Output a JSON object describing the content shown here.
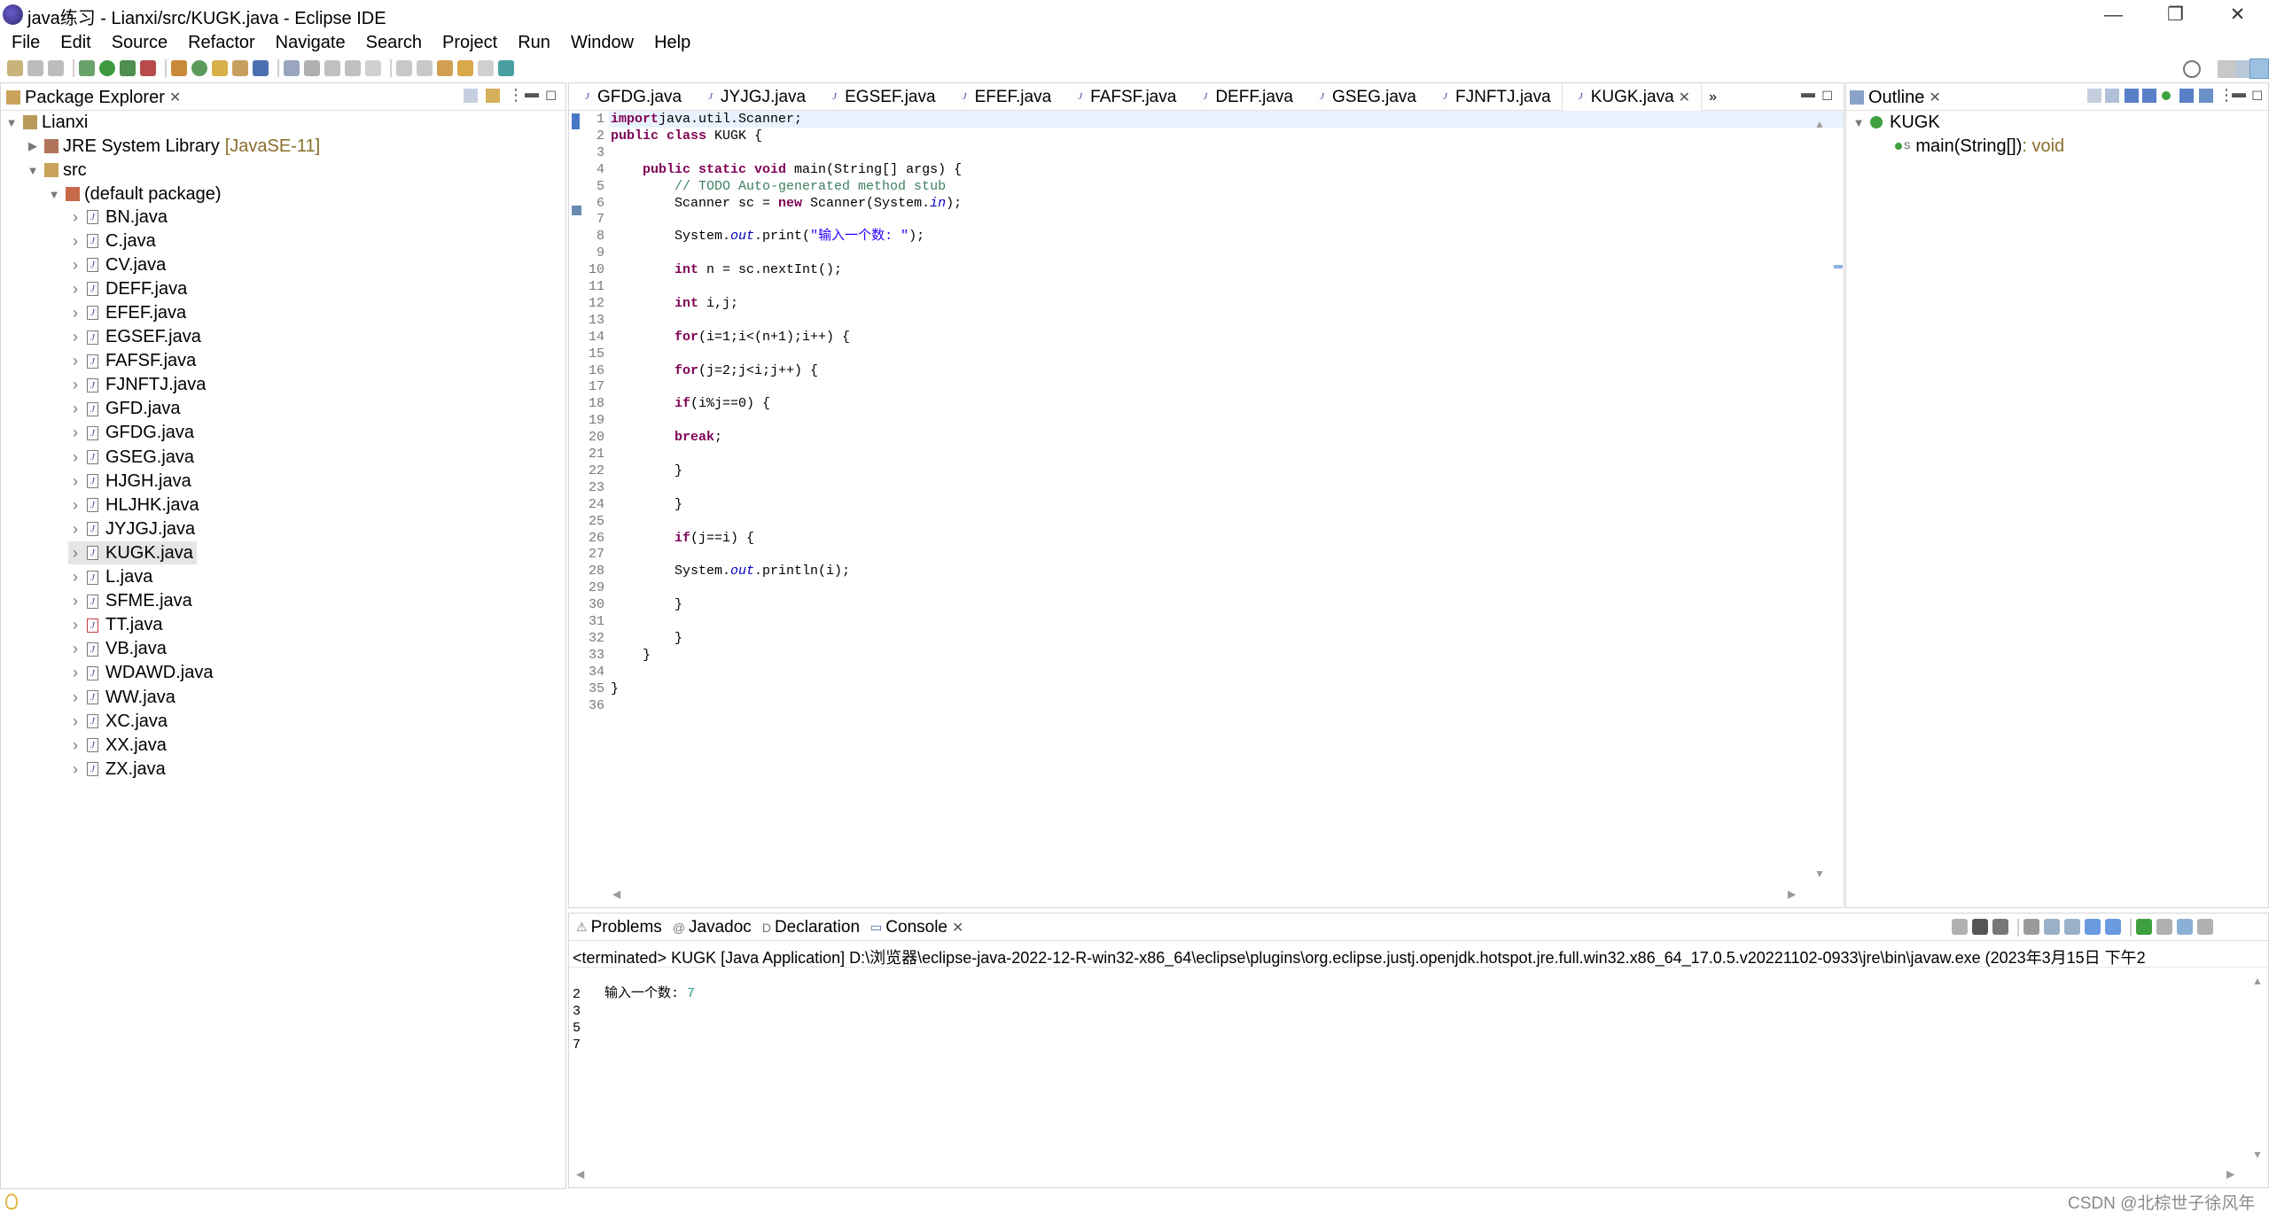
{
  "window": {
    "title": "java练习 - Lianxi/src/KUGK.java - Eclipse IDE",
    "minimize_glyph": "—",
    "restore_glyph": "❐",
    "close_glyph": "✕"
  },
  "menu": [
    "File",
    "Edit",
    "Source",
    "Refactor",
    "Navigate",
    "Search",
    "Project",
    "Run",
    "Window",
    "Help"
  ],
  "package_explorer": {
    "title": "Package Explorer",
    "project": "Lianxi",
    "jre_label": "JRE System Library",
    "jre_version": "[JavaSE-11]",
    "src": "src",
    "default_package": "(default package)",
    "files": [
      "BN.java",
      "C.java",
      "CV.java",
      "DEFF.java",
      "EFEF.java",
      "EGSEF.java",
      "FAFSF.java",
      "FJNFTJ.java",
      "GFD.java",
      "GFDG.java",
      "GSEG.java",
      "HJGH.java",
      "HLJHK.java",
      "JYJGJ.java",
      "KUGK.java",
      "L.java",
      "SFME.java",
      "TT.java",
      "VB.java",
      "WDAWD.java",
      "WW.java",
      "XC.java",
      "XX.java",
      "ZX.java"
    ],
    "selected_file": "KUGK.java"
  },
  "editor": {
    "tabs": [
      "GFDG.java",
      "JYJGJ.java",
      "EGSEF.java",
      "EFEF.java",
      "FAFSF.java",
      "DEFF.java",
      "GSEG.java",
      "FJNFTJ.java",
      "KUGK.java"
    ],
    "active_tab": "KUGK.java",
    "overflow_glyph": "»",
    "lines": [
      [
        [
          "kw",
          "import"
        ],
        [
          "",
          "java.util.Scanner;"
        ]
      ],
      [
        [
          "kw",
          "public class"
        ],
        [
          "",
          " KUGK {"
        ]
      ],
      [],
      [
        [
          "",
          "    "
        ],
        [
          "kw",
          "public static void"
        ],
        [
          "",
          ""
        ],
        [
          "",
          " main(String[] args) {"
        ]
      ],
      [
        [
          "",
          "        "
        ],
        [
          "cm",
          "// TODO Auto-generated method stub"
        ]
      ],
      [
        [
          "",
          "        Scanner sc = "
        ],
        [
          "kw",
          "new"
        ],
        [
          "",
          " Scanner(System."
        ],
        [
          "fld",
          "in"
        ],
        [
          "",
          ");"
        ]
      ],
      [],
      [
        [
          "",
          "        System."
        ],
        [
          "fld",
          "out"
        ],
        [
          "",
          ".print("
        ],
        [
          "str",
          "\"输入一个数: \""
        ],
        [
          "",
          ");"
        ]
      ],
      [],
      [
        [
          "",
          "        "
        ],
        [
          "kw",
          "int"
        ],
        [
          "",
          " n = sc.nextInt();"
        ]
      ],
      [],
      [
        [
          "",
          "        "
        ],
        [
          "kw",
          "int"
        ],
        [
          "",
          " i,j;"
        ]
      ],
      [],
      [
        [
          "",
          "        "
        ],
        [
          "kw",
          "for"
        ],
        [
          "",
          "(i=1;i<(n+1);i++) {"
        ]
      ],
      [],
      [
        [
          "",
          "        "
        ],
        [
          "kw",
          "for"
        ],
        [
          "",
          "(j=2;j<i;j++) {"
        ]
      ],
      [],
      [
        [
          "",
          "        "
        ],
        [
          "kw",
          "if"
        ],
        [
          "",
          "(i%j==0) {"
        ]
      ],
      [],
      [
        [
          "",
          "        "
        ],
        [
          "kw",
          "break"
        ],
        [
          "",
          ";"
        ]
      ],
      [],
      [
        [
          "",
          "        }"
        ]
      ],
      [],
      [
        [
          "",
          "        }"
        ]
      ],
      [],
      [
        [
          "",
          "        "
        ],
        [
          "kw",
          "if"
        ],
        [
          "",
          "(j==i) {"
        ]
      ],
      [],
      [
        [
          "",
          "        System."
        ],
        [
          "fld",
          "out"
        ],
        [
          "",
          ".println(i);"
        ]
      ],
      [],
      [
        [
          "",
          "        }"
        ]
      ],
      [],
      [
        [
          "",
          "        }"
        ]
      ],
      [
        [
          "",
          "    }"
        ]
      ],
      [],
      [
        [
          "",
          "}"
        ]
      ],
      []
    ]
  },
  "outline": {
    "title": "Outline",
    "class_name": "KUGK",
    "method_name": "main(String[])",
    "method_return": " : void",
    "static_marker": "S"
  },
  "bottom": {
    "tabs": [
      "Problems",
      "Javadoc",
      "Declaration",
      "Console"
    ],
    "active_tab": "Console",
    "icons": [
      "⚠",
      "@",
      "D",
      "▭"
    ],
    "terminated_line": "<terminated> KUGK [Java Application] D:\\浏览器\\eclipse-java-2022-12-R-win32-x86_64\\eclipse\\plugins\\org.eclipse.justj.openjdk.hotspot.jre.full.win32.x86_64_17.0.5.v20221102-0933\\jre\\bin\\javaw.exe  (2023年3月15日 下午2",
    "prompt": "输入一个数: ",
    "user_input": "7",
    "output": [
      "2",
      "3",
      "5",
      "7"
    ]
  },
  "status": {
    "watermark": "CSDN @北棕世子徐风年"
  },
  "colors": {
    "keyword": "#7f0055",
    "comment": "#3f7f5f",
    "string": "#2a00ff",
    "field": "#0000c0",
    "input": "#1b9a8a",
    "jre_version": "#8a6d2a"
  }
}
